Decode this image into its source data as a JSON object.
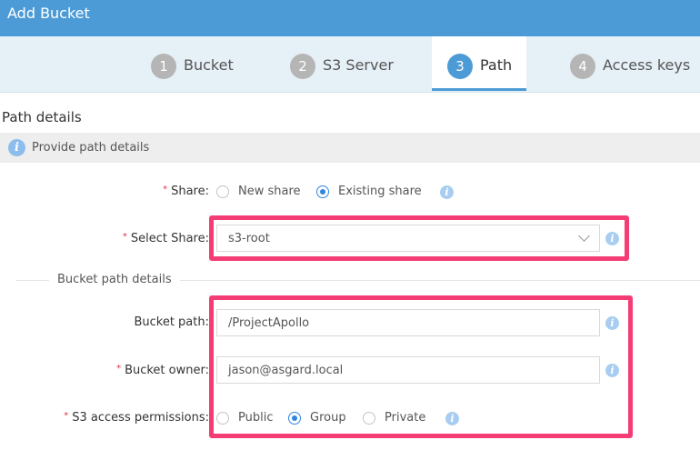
{
  "window": {
    "title": "Add Bucket"
  },
  "steps": [
    {
      "num": "1",
      "label": "Bucket"
    },
    {
      "num": "2",
      "label": "S3 Server"
    },
    {
      "num": "3",
      "label": "Path",
      "active": true
    },
    {
      "num": "4",
      "label": "Access keys"
    }
  ],
  "section": {
    "title": "Path details"
  },
  "info_banner": {
    "text": "Provide path details"
  },
  "share": {
    "label": "Share",
    "required": "*",
    "options": [
      "New share",
      "Existing share"
    ],
    "selected": "Existing share"
  },
  "select_share": {
    "label": "Select Share",
    "required": "*",
    "value": "s3-root"
  },
  "bucket_path_group": {
    "title": "Bucket path details"
  },
  "bucket_path": {
    "label": "Bucket path",
    "value": "/ProjectApollo"
  },
  "bucket_owner": {
    "label": "Bucket owner",
    "required": "*",
    "value": "jason@asgard.local"
  },
  "permissions": {
    "label": "S3 access permissions",
    "required": "*",
    "options": [
      "Public",
      "Group",
      "Private"
    ],
    "selected": "Group"
  },
  "colors": {
    "accent": "#4d9bd6",
    "highlight": "#f33d74",
    "required": "#e0334b"
  },
  "icons": {
    "info": "info-icon",
    "colon": ":"
  }
}
